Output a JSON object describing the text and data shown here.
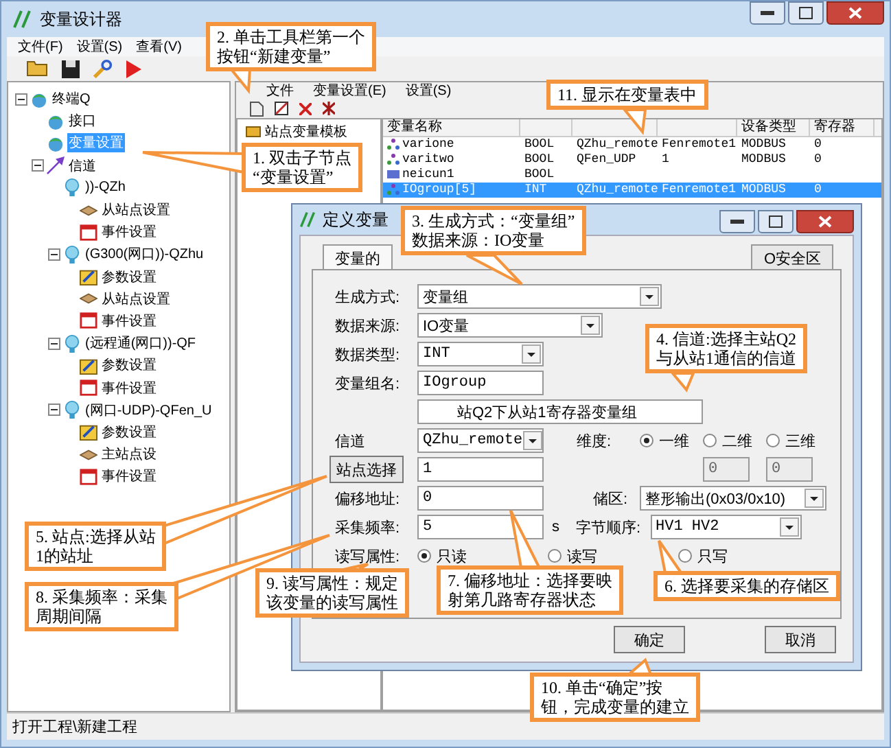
{
  "window": {
    "title": "变量设计器"
  },
  "menu": [
    "文件(F)",
    "设置(S)",
    "查看(V)"
  ],
  "toolbar": [
    {
      "kind": "open"
    },
    {
      "kind": "save"
    },
    {
      "kind": "key"
    },
    {
      "kind": "run"
    }
  ],
  "tree": [
    {
      "label": "终端Q",
      "kind": "terminal",
      "expanded": true,
      "selected": false,
      "children": [
        {
          "label": "接口",
          "kind": "terminal",
          "selected": false
        },
        {
          "label": "变量设置",
          "kind": "terminal",
          "selected": true
        },
        {
          "label": "信道",
          "kind": "channel",
          "expanded": true,
          "selected": false,
          "children": [
            {
              "label": "))-QZh",
              "kind": "device",
              "selected": false,
              "children": [
                {
                  "label": "从站点设置",
                  "kind": "station",
                  "selected": false
                },
                {
                  "label": "事件设置",
                  "kind": "event",
                  "selected": false
                }
              ]
            },
            {
              "label": "(G300(网口))-QZhu",
              "kind": "device",
              "expanded": true,
              "selected": false,
              "children": [
                {
                  "label": "参数设置",
                  "kind": "params",
                  "selected": false
                },
                {
                  "label": "从站点设置",
                  "kind": "station",
                  "selected": false
                },
                {
                  "label": "事件设置",
                  "kind": "event",
                  "selected": false
                }
              ]
            },
            {
              "label": "(远程通(网口))-QF",
              "kind": "device",
              "expanded": true,
              "selected": false,
              "children": [
                {
                  "label": "参数设置",
                  "kind": "params",
                  "selected": false
                },
                {
                  "label": "事件设置",
                  "kind": "event",
                  "selected": false
                }
              ]
            },
            {
              "label": "(网口-UDP)-QFen_U",
              "kind": "device",
              "expanded": true,
              "selected": false,
              "children": [
                {
                  "label": "参数设置",
                  "kind": "params",
                  "selected": false
                },
                {
                  "label": "主站点设",
                  "kind": "station",
                  "selected": false
                },
                {
                  "label": "事件设置",
                  "kind": "event",
                  "selected": false
                }
              ]
            }
          ]
        }
      ]
    }
  ],
  "editor": {
    "menu": [
      "文件",
      "变量设置(E)",
      "设置(S)"
    ],
    "toolbar": [
      {
        "kind": "new"
      },
      {
        "kind": "edit"
      },
      {
        "kind": "delete"
      },
      {
        "kind": "delete_all"
      }
    ],
    "tree": [
      {
        "label": "站点变量模板"
      }
    ],
    "table": {
      "headers": {
        "column_1": "变量名称",
        "column_5": "设备类型",
        "column_6": "寄存器"
      },
      "rows": [
        {
          "kind": "variable",
          "selected": false,
          "cells": [
            "varione",
            "BOOL",
            "QZhu_remote",
            "Fenremote1",
            "MODBUS",
            "0"
          ]
        },
        {
          "kind": "variable",
          "selected": false,
          "cells": [
            "varitwo",
            "BOOL",
            "QFen_UDP",
            "1",
            "MODBUS",
            "0"
          ]
        },
        {
          "kind": "memory",
          "selected": false,
          "cells": [
            "neicun1",
            "BOOL",
            "",
            "",
            "",
            ""
          ]
        },
        {
          "kind": "variable",
          "selected": true,
          "cells": [
            "IOgroup[5]",
            "INT",
            "QZhu_remote",
            "Fenremote1",
            "MODBUS",
            "0"
          ]
        }
      ]
    }
  },
  "dialog": {
    "title": "定义变量",
    "tabs": [
      {
        "label": "变量的",
        "selected": true
      },
      {
        "label": "O安全区",
        "selected": false
      }
    ],
    "gen_mode": {
      "label": "生成方式:",
      "value": "变量组"
    },
    "source": {
      "label": "数据来源:",
      "value": "IO变量"
    },
    "data_type": {
      "label": "数据类型:",
      "value": "INT"
    },
    "group_name": {
      "label": "变量组名:",
      "value": "IOgroup"
    },
    "description": {
      "value": "站Q2下从站1寄存器变量组"
    },
    "channel": {
      "label": "信道",
      "value": "QZhu_remote"
    },
    "dimension": {
      "label": "维度:",
      "options": [
        {
          "label": "一维",
          "selected": true
        },
        {
          "label": "二维",
          "selected": false
        },
        {
          "label": "三维",
          "selected": false
        }
      ]
    },
    "station": {
      "button": "站点选择",
      "value": "1"
    },
    "dim_values": [
      {
        "value": "0",
        "disabled": true
      },
      {
        "value": "0",
        "disabled": true
      }
    ],
    "offset": {
      "label": "偏移地址:",
      "value": "0"
    },
    "storage": {
      "label": "储区:",
      "value": "整形输出(0x03/0x10)"
    },
    "frequency": {
      "label": "采集频率:",
      "value": "5",
      "unit": "s"
    },
    "byte_order": {
      "label": "字节顺序:",
      "value": "HV1 HV2"
    },
    "access": {
      "label": "读写属性:",
      "options": [
        {
          "label": "只读",
          "selected": true
        },
        {
          "label": "读写",
          "selected": false
        },
        {
          "label": "只写",
          "selected": false
        }
      ]
    },
    "buttons": [
      "确定",
      "取消"
    ]
  },
  "status_bar": "打开工程\\新建工程",
  "callouts": [
    {
      "lines": [
        "2. 单击工具栏第一个",
        "按钮“新建变量”"
      ]
    },
    {
      "lines": [
        "11. 显示在变量表中"
      ]
    },
    {
      "lines": [
        "1. 双击子节点",
        "“变量设置”"
      ]
    },
    {
      "lines": [
        "3. 生成方式：“变量组”",
        "数据来源：IO变量"
      ]
    },
    {
      "lines": [
        "4. 信道:选择主站Q2",
        "与从站1通信的信道"
      ]
    },
    {
      "lines": [
        "5. 站点:选择从站",
        "1的站址"
      ]
    },
    {
      "lines": [
        "8. 采集频率：采集",
        "周期间隔"
      ]
    },
    {
      "lines": [
        "9. 读写属性：规定",
        "该变量的读写属性"
      ]
    },
    {
      "lines": [
        "7. 偏移地址：选择要映",
        "射第几路寄存器状态"
      ]
    },
    {
      "lines": [
        "6. 选择要采集的存储区"
      ]
    },
    {
      "lines": [
        "10. 单击“确定”按",
        "钮，完成变量的建立"
      ]
    }
  ]
}
